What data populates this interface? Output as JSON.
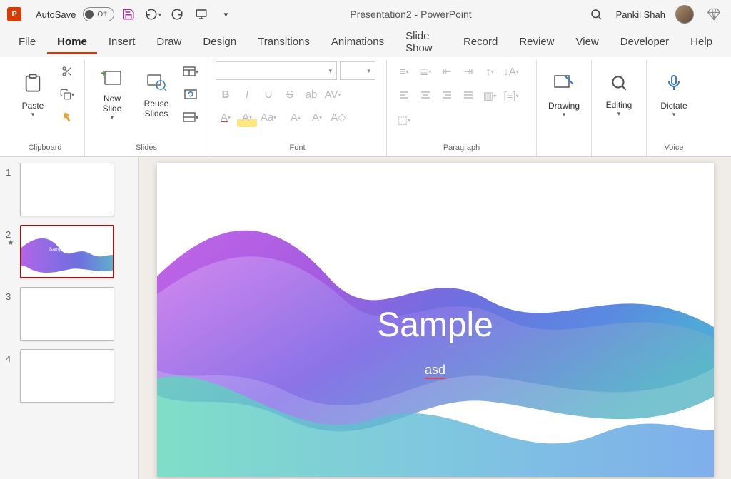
{
  "titlebar": {
    "autosave_label": "AutoSave",
    "autosave_state": "Off",
    "doc_title": "Presentation2 - PowerPoint",
    "user_name": "Pankil Shah"
  },
  "tabs": [
    "File",
    "Home",
    "Insert",
    "Draw",
    "Design",
    "Transitions",
    "Animations",
    "Slide Show",
    "Record",
    "Review",
    "View",
    "Developer",
    "Help"
  ],
  "active_tab": "Home",
  "ribbon": {
    "clipboard": {
      "label": "Clipboard",
      "paste": "Paste"
    },
    "slides": {
      "label": "Slides",
      "new_slide": "New\nSlide",
      "reuse": "Reuse\nSlides"
    },
    "font": {
      "label": "Font"
    },
    "paragraph": {
      "label": "Paragraph"
    },
    "drawing": {
      "label": "Drawing"
    },
    "editing": {
      "label": "Editing"
    },
    "voice": {
      "label": "Voice",
      "dictate": "Dictate"
    }
  },
  "slides_panel": {
    "thumbs": [
      {
        "num": "1",
        "selected": false,
        "has_wave": false
      },
      {
        "num": "2",
        "selected": true,
        "has_wave": true,
        "starred": true
      },
      {
        "num": "3",
        "selected": false,
        "has_wave": false
      },
      {
        "num": "4",
        "selected": false,
        "has_wave": false
      }
    ]
  },
  "slide": {
    "title": "Sample",
    "subtitle": "asd"
  }
}
